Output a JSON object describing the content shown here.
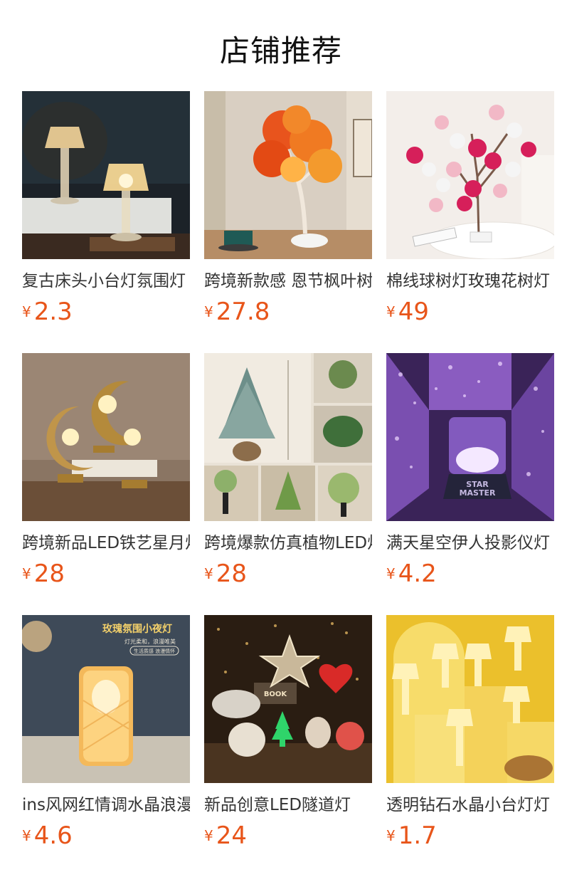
{
  "header": {
    "title": "店铺推荐"
  },
  "currency": "¥",
  "products": [
    {
      "name": "复古床头小台灯氛围灯",
      "price": "2.3",
      "image": "crystal-lamps-on-books"
    },
    {
      "name": "跨境新款感 恩节枫叶树灯",
      "price": "27.8",
      "image": "maple-leaf-tree-lamp"
    },
    {
      "name": "棉线球树灯玫瑰花树灯",
      "price": "49",
      "image": "cotton-ball-tree-lamp"
    },
    {
      "name": "跨境新品LED铁艺星月灯",
      "price": "28",
      "image": "iron-moon-lamps"
    },
    {
      "name": "跨境爆款仿真植物LED灯",
      "price": "28",
      "image": "artificial-plant-lamps"
    },
    {
      "name": "满天星空伊人投影仪灯",
      "price": "4.2",
      "image": "star-projector"
    },
    {
      "name": "ins风网红情调水晶浪漫台灯",
      "price": "4.6",
      "image": "rose-crystal-lamp"
    },
    {
      "name": "新品创意LED隧道灯",
      "price": "24",
      "image": "led-tunnel-lamps"
    },
    {
      "name": "透明钻石水晶小台灯灯",
      "price": "1.7",
      "image": "crystal-mini-lamps"
    }
  ],
  "image_texts": {
    "rose_lamp_headline": "玫瑰氛围小夜灯",
    "rose_lamp_subline": "灯光柔和，浪漫唯美",
    "rose_lamp_badge": "生活质感 浪漫情怀",
    "projector_label_1": "STAR",
    "projector_label_2": "MASTER",
    "tunnel_box_label": "BOOK"
  }
}
